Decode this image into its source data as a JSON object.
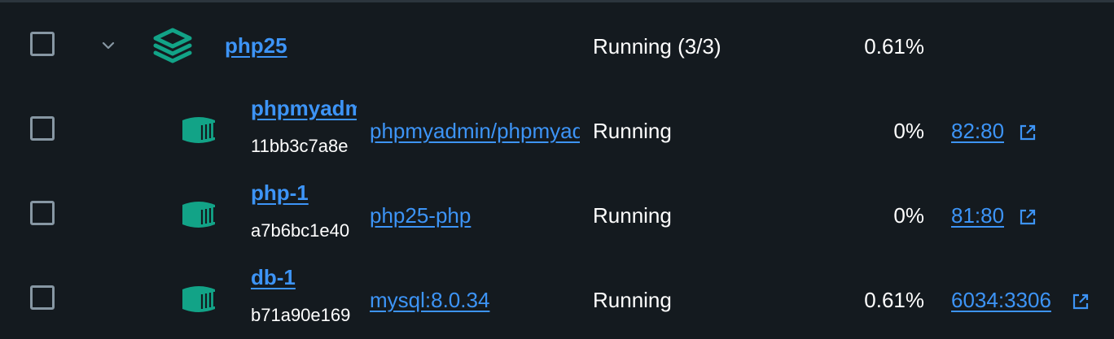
{
  "group": {
    "name": "php25",
    "status": "Running (3/3)",
    "cpu": "0.61%",
    "stack_icon": "stack-layers-icon",
    "chevron_icon": "chevron-down-icon"
  },
  "containers": [
    {
      "name": "phpmyadmin",
      "id": "11bb3c7a8e",
      "image": "phpmyadmin/phpmyadmin",
      "status": "Running",
      "cpu": "0%",
      "port": "82:80",
      "icon": "container-icon"
    },
    {
      "name": "php-1",
      "id": "a7b6bc1e40",
      "image": "php25-php",
      "status": "Running",
      "cpu": "0%",
      "port": "81:80",
      "icon": "container-icon"
    },
    {
      "name": "db-1",
      "id": "b71a90e169",
      "image": "mysql:8.0.34",
      "status": "Running",
      "cpu": "0.61%",
      "port": "6034:3306",
      "icon": "container-icon"
    }
  ],
  "colors": {
    "background": "#141a1f",
    "link": "#3d94f6",
    "icon_teal": "#12a387",
    "checkbox_border": "#8797a3"
  }
}
